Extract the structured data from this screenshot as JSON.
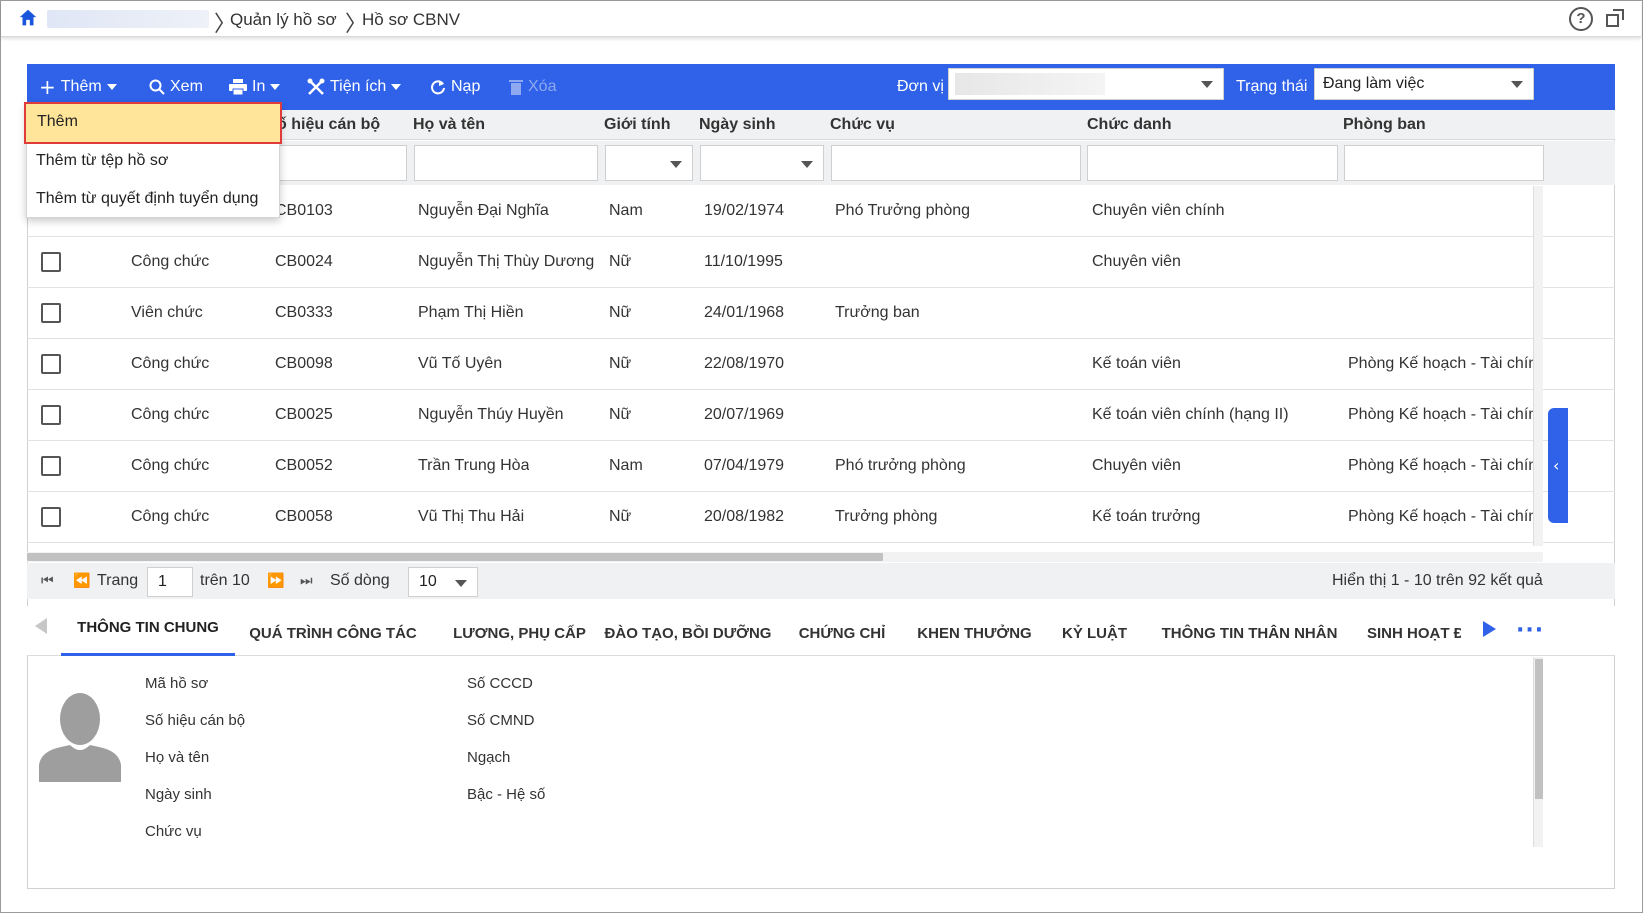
{
  "breadcrumb": {
    "items": [
      "Quản lý hồ sơ",
      "Hồ sơ CBNV"
    ]
  },
  "toolbar": {
    "add_label": "Thêm",
    "view_label": "Xem",
    "print_label": "In",
    "utility_label": "Tiện ích",
    "reload_label": "Nạp",
    "delete_label": "Xóa",
    "unit_label": "Đơn vị",
    "status_label": "Trạng thái",
    "status_value": "Đang làm việc"
  },
  "add_menu": {
    "items": [
      "Thêm",
      "Thêm từ tệp hồ sơ",
      "Thêm từ quyết định tuyển dụng"
    ]
  },
  "grid": {
    "columns": [
      "ố hiệu cán bộ",
      "Họ và tên",
      "Giới tính",
      "Ngày sinh",
      "Chức vụ",
      "Chức danh",
      "Phòng ban"
    ],
    "rows": [
      {
        "type": "",
        "code": "CB0103",
        "name": "Nguyễn Đại Nghĩa",
        "gender": "Nam",
        "dob": "19/02/1974",
        "position": "Phó Trưởng phòng",
        "title": "Chuyên viên chính",
        "dept": ""
      },
      {
        "type": "Công chức",
        "code": "CB0024",
        "name": "Nguyễn Thị Thùy Dương",
        "gender": "Nữ",
        "dob": "11/10/1995",
        "position": "",
        "title": "Chuyên viên",
        "dept": ""
      },
      {
        "type": "Viên chức",
        "code": "CB0333",
        "name": "Phạm Thị Hiền",
        "gender": "Nữ",
        "dob": "24/01/1968",
        "position": "Trưởng ban",
        "title": "",
        "dept": ""
      },
      {
        "type": "Công chức",
        "code": "CB0098",
        "name": "Vũ Tố Uyên",
        "gender": "Nữ",
        "dob": "22/08/1970",
        "position": "",
        "title": "Kế toán viên",
        "dept": "Phòng Kế hoạch - Tài chính"
      },
      {
        "type": "Công chức",
        "code": "CB0025",
        "name": "Nguyễn Thúy Huyền",
        "gender": "Nữ",
        "dob": "20/07/1969",
        "position": "",
        "title": "Kế toán viên chính (hạng II)",
        "dept": "Phòng Kế hoạch - Tài chính"
      },
      {
        "type": "Công chức",
        "code": "CB0052",
        "name": "Trần Trung Hòa",
        "gender": "Nam",
        "dob": "07/04/1979",
        "position": "Phó trưởng phòng",
        "title": "Chuyên viên",
        "dept": "Phòng Kế hoạch - Tài chính"
      },
      {
        "type": "Công chức",
        "code": "CB0058",
        "name": "Vũ Thị Thu Hải",
        "gender": "Nữ",
        "dob": "20/08/1982",
        "position": "Trưởng phòng",
        "title": "Kế toán trưởng",
        "dept": "Phòng Kế hoạch - Tài chính"
      }
    ]
  },
  "pager": {
    "page_label": "Trang",
    "page_value": "1",
    "of_label": "trên 10",
    "rows_label": "Số dòng",
    "rows_value": "10",
    "summary": "Hiển thị 1 - 10 trên 92 kết quả"
  },
  "tabs": [
    "THÔNG TIN CHUNG",
    "QUÁ TRÌNH CÔNG TÁC",
    "LƯƠNG, PHỤ CẤP",
    "ĐÀO TẠO, BỒI DƯỠNG",
    "CHỨNG CHỈ",
    "KHEN THƯỞNG",
    "KỶ LUẬT",
    "THÔNG TIN THÂN NHÂN",
    "SINH HOẠT Đ"
  ],
  "details": {
    "left_labels": [
      "Mã hồ sơ",
      "Số hiệu cán bộ",
      "Họ và tên",
      "Ngày sinh",
      "Chức vụ"
    ],
    "right_labels": [
      "Số CCCD",
      "Số CMND",
      "Ngạch",
      "Bậc - Hệ số"
    ]
  },
  "colors": {
    "accent": "#2f62e8",
    "menu_highlight": "#ffe599",
    "menu_highlight_border": "#e03b3b"
  }
}
